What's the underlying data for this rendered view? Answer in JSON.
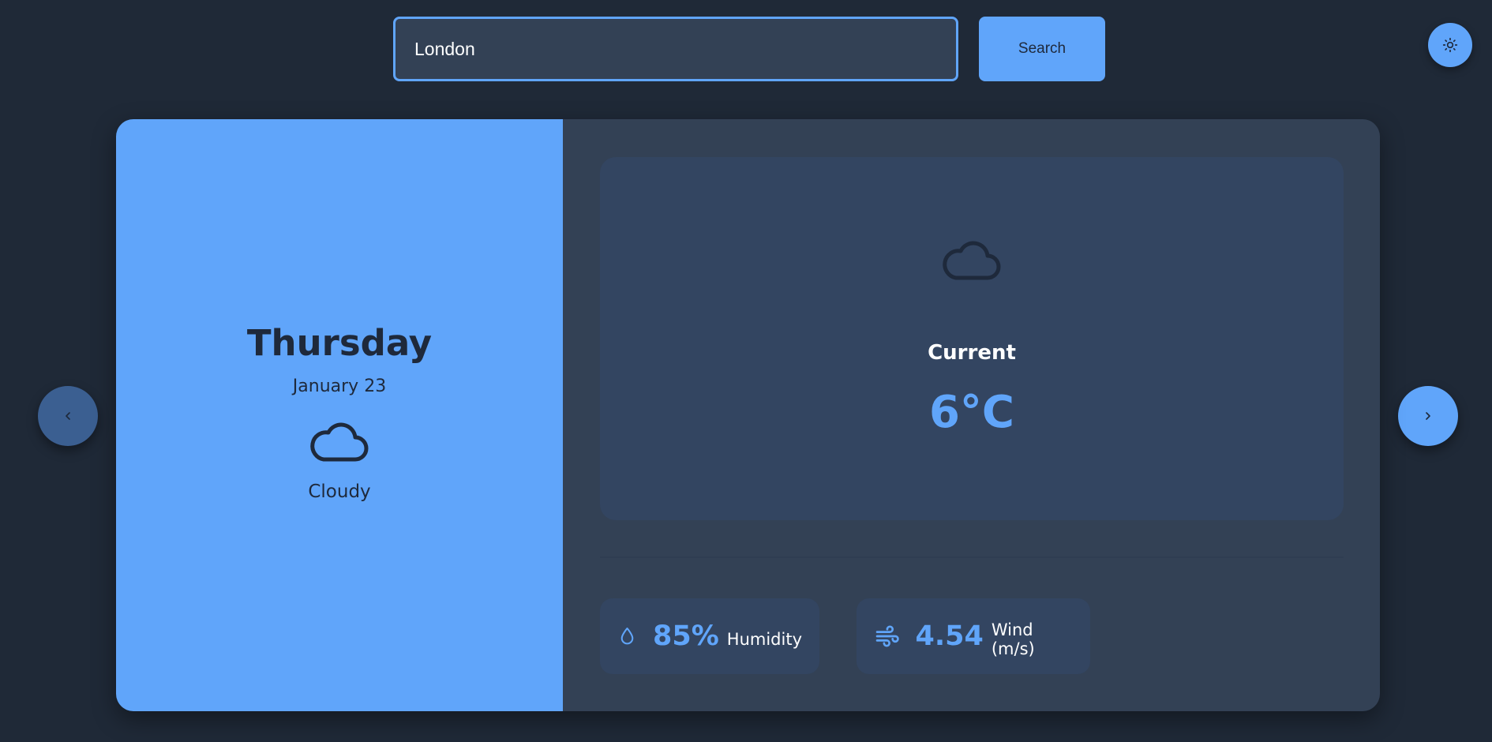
{
  "search": {
    "value": "London",
    "button_label": "Search"
  },
  "theme_toggle": {
    "icon": "sun-icon"
  },
  "navigation": {
    "prev_icon": "chevron-left-icon",
    "next_icon": "chevron-right-icon"
  },
  "day": {
    "name": "Thursday",
    "date": "January 23",
    "icon": "cloud-icon",
    "condition": "Cloudy"
  },
  "current": {
    "icon": "cloud-icon",
    "label": "Current",
    "temperature": "6°C"
  },
  "stats": {
    "humidity": {
      "icon": "droplet-icon",
      "value": "85%",
      "label": "Humidity"
    },
    "wind": {
      "icon": "wind-icon",
      "value": "4.54",
      "label": "Wind (m/s)"
    }
  },
  "colors": {
    "background": "#1f2937",
    "accent": "#60a5fa",
    "panel": "#334155",
    "box": "#334561",
    "dark_text": "#1e293b"
  }
}
